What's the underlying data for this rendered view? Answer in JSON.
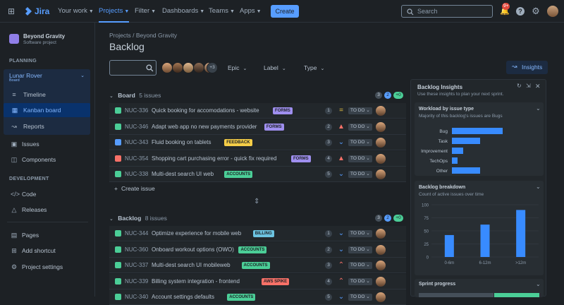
{
  "topbar": {
    "product": "Jira",
    "nav": [
      {
        "label": "Your work",
        "active": false
      },
      {
        "label": "Projects",
        "active": true
      },
      {
        "label": "Filter",
        "active": false
      },
      {
        "label": "Dashboards",
        "active": false
      },
      {
        "label": "Teams",
        "active": false
      },
      {
        "label": "Apps",
        "active": false
      }
    ],
    "create_label": "Create",
    "search_placeholder": "Search",
    "notification_count": "9+"
  },
  "sidebar": {
    "project_name": "Beyond Gravity",
    "project_type": "Software project",
    "planning_label": "PLANNING",
    "board_name": "Lunar Rover",
    "board_sub": "Board",
    "board_items": [
      {
        "label": "Timeline",
        "icon": "timeline-icon"
      },
      {
        "label": "Kanban board",
        "icon": "kanban-icon"
      },
      {
        "label": "Reports",
        "icon": "reports-icon"
      }
    ],
    "items_a": [
      {
        "label": "Issues",
        "icon": "issues-icon"
      },
      {
        "label": "Components",
        "icon": "components-icon"
      }
    ],
    "development_label": "DEVELOPMENT",
    "items_b": [
      {
        "label": "Code",
        "icon": "code-icon"
      },
      {
        "label": "Releases",
        "icon": "releases-icon"
      }
    ],
    "items_c": [
      {
        "label": "Pages",
        "icon": "pages-icon"
      },
      {
        "label": "Add shortcut",
        "icon": "add-shortcut-icon"
      },
      {
        "label": "Project settings",
        "icon": "settings-icon"
      }
    ]
  },
  "main": {
    "breadcrumb": [
      "Projects",
      "Beyond Gravity"
    ],
    "title": "Backlog",
    "extra_avatars": "+3",
    "filters": [
      "Epic",
      "Label",
      "Type"
    ],
    "insights_label": "Insights",
    "board": {
      "name": "Board",
      "count": "5 issues",
      "pills": [
        "3",
        "2",
        "+0"
      ],
      "create_label": "Create issue",
      "rows": [
        {
          "type": "story",
          "key": "NUC-336",
          "summary": "Quick booking for accomodations - website",
          "epic": "FORMS",
          "epic_color": "#9f8fef",
          "est": "1",
          "priority": "medium",
          "status": "TO DO"
        },
        {
          "type": "story",
          "key": "NUC-346",
          "summary": "Adapt web app no new payments provider",
          "epic": "FORMS",
          "epic_color": "#9f8fef",
          "est": "2",
          "priority": "highest",
          "status": "TO DO"
        },
        {
          "type": "task",
          "key": "NUC-343",
          "summary": "Fluid booking on tablets",
          "epic": "FEEDBACK",
          "epic_color": "#f5cd47",
          "est": "3",
          "priority": "lowest",
          "status": "TO DO"
        },
        {
          "type": "bug",
          "key": "NUC-354",
          "summary": "Shopping cart purchasing error - quick fix required",
          "epic": "FORMS",
          "epic_color": "#9f8fef",
          "est": "4",
          "priority": "highest",
          "status": "TO DO"
        },
        {
          "type": "story",
          "key": "NUC-338",
          "summary": "Multi-dest search UI web",
          "epic": "ACCOUNTS",
          "epic_color": "#4bce97",
          "est": "5",
          "priority": "low",
          "status": "TO DO"
        }
      ]
    },
    "backlog": {
      "name": "Backlog",
      "count": "8 issues",
      "pills": [
        "3",
        "2",
        "+0"
      ],
      "rows": [
        {
          "type": "story",
          "key": "NUC-344",
          "summary": "Optimize experience for mobile web",
          "epic": "BILLING",
          "epic_color": "#6cc3e0",
          "est": "1",
          "priority": "lowest",
          "status": "TO DO"
        },
        {
          "type": "story",
          "key": "NUC-360",
          "summary": "Onboard workout options (OWO)",
          "epic": "ACCOUNTS",
          "epic_color": "#4bce97",
          "est": "2",
          "priority": "lowest",
          "status": "TO DO"
        },
        {
          "type": "story",
          "key": "NUC-337",
          "summary": "Multi-dest search UI mobileweb",
          "epic": "ACCOUNTS",
          "epic_color": "#4bce97",
          "est": "3",
          "priority": "high",
          "status": "TO DO"
        },
        {
          "type": "story",
          "key": "NUC-339",
          "summary": "Billing system integration - frontend",
          "epic": "AWS SPIKE",
          "epic_color": "#f87168",
          "est": "4",
          "priority": "high",
          "status": "TO DO"
        },
        {
          "type": "story",
          "key": "NUC-340",
          "summary": "Account settings defaults",
          "epic": "ACCOUNTS",
          "epic_color": "#4bce97",
          "est": "5",
          "priority": "low",
          "status": "TO DO"
        }
      ]
    }
  },
  "insights": {
    "title": "Backlog Insights",
    "subtitle": "Use these insights to plan your next sprint.",
    "workload": {
      "title": "Workload by issue type",
      "subtitle": "Majority of this backlog's issues are Bugs"
    },
    "breakdown": {
      "title": "Backlog breakdown",
      "subtitle": "Count of active issues over time"
    },
    "sprint": {
      "title": "Sprint progress"
    }
  },
  "chart_data": [
    {
      "type": "bar",
      "orientation": "horizontal",
      "categories": [
        "Bug",
        "Task",
        "Improvement",
        "TechOps",
        "Other"
      ],
      "values": [
        9,
        5,
        2,
        1,
        5
      ],
      "title": "Workload by issue type"
    },
    {
      "type": "bar",
      "categories": [
        "0-6m",
        "6-12m",
        ">12m"
      ],
      "values": [
        42,
        62,
        90
      ],
      "yticks": [
        "100",
        "75",
        "50",
        "25",
        "0"
      ],
      "ylim": [
        0,
        100
      ],
      "title": "Backlog breakdown",
      "grid": true
    }
  ]
}
